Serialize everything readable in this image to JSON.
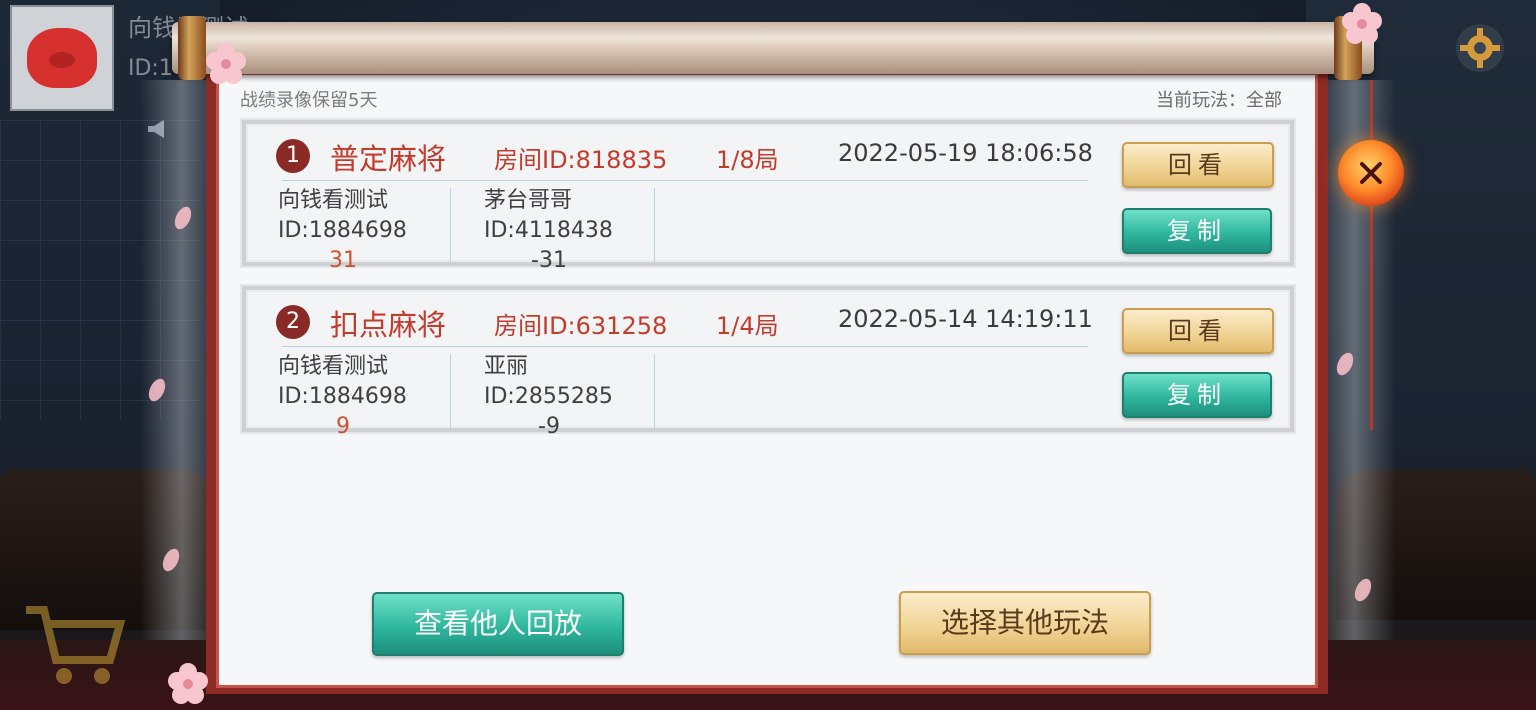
{
  "top_left": {
    "player_name": "向钱看测试",
    "player_id_label": "ID:1"
  },
  "header": {
    "retention_note": "战绩录像保留5天",
    "current_mode_label": "当前玩法：全部"
  },
  "records": [
    {
      "index": "1",
      "game_name": "普定麻将",
      "room_id": "房间ID:818835",
      "rounds": "1/8局",
      "datetime": "2022-05-19 18:06:58",
      "players": [
        {
          "name": "向钱看测试",
          "id": "ID:1884698",
          "score": "31"
        },
        {
          "name": "茅台哥哥",
          "id": "ID:4118438",
          "score": "-31"
        }
      ],
      "replay_label": "回看",
      "copy_label": "复制"
    },
    {
      "index": "2",
      "game_name": "扣点麻将",
      "room_id": "房间ID:631258",
      "rounds": "1/4局",
      "datetime": "2022-05-14 14:19:11",
      "players": [
        {
          "name": "向钱看测试",
          "id": "ID:1884698",
          "score": "9"
        },
        {
          "name": "亚丽",
          "id": "ID:2855285",
          "score": "-9"
        }
      ],
      "replay_label": "回看",
      "copy_label": "复制"
    }
  ],
  "footer": {
    "view_others_label": "查看他人回放",
    "choose_mode_label": "选择其他玩法"
  },
  "icons": {
    "settings": "gear-icon",
    "close": "close-icon",
    "announcement": "horn-icon",
    "shop": "cart-icon"
  },
  "colors": {
    "accent_red": "#c43b2c",
    "frame_red": "#8d2b25",
    "teal_button": "#2fb79e",
    "gold_button": "#f1d597"
  }
}
